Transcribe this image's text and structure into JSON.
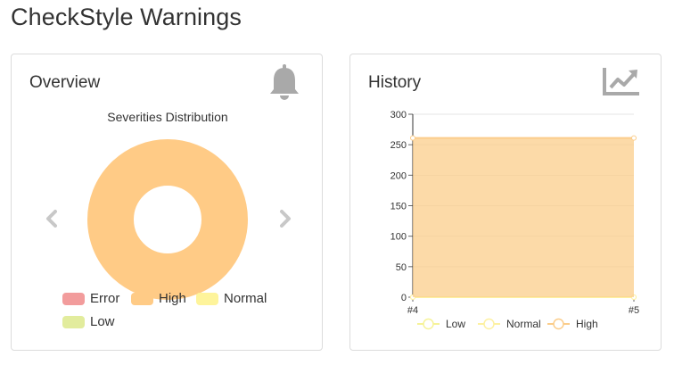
{
  "page": {
    "title": "CheckStyle Warnings"
  },
  "overview": {
    "title": "Overview",
    "icon": "bell-icon",
    "subtitle": "Severities Distribution",
    "prev_icon": "chevron-left-icon",
    "next_icon": "chevron-right-icon",
    "legend": [
      {
        "label": "Error",
        "color": "#f29c9c"
      },
      {
        "label": "High",
        "color": "#ffcb86"
      },
      {
        "label": "Normal",
        "color": "#fef49b"
      },
      {
        "label": "Low",
        "color": "#e2ec9d"
      }
    ]
  },
  "history": {
    "title": "History",
    "icon": "trend-chart-icon",
    "legend": [
      {
        "label": "Low",
        "color": "#f6f399"
      },
      {
        "label": "Normal",
        "color": "#fdf1a2"
      },
      {
        "label": "High",
        "color": "#fbcd8b"
      }
    ]
  },
  "chart_data": [
    {
      "type": "pie",
      "title": "Severities Distribution",
      "categories": [
        "Error",
        "High",
        "Normal",
        "Low"
      ],
      "values": [
        0,
        261,
        0,
        0
      ],
      "colors": [
        "#f29c9c",
        "#ffcb86",
        "#fef49b",
        "#e2ec9d"
      ],
      "legend_position": "bottom"
    },
    {
      "type": "area",
      "x": [
        "#4",
        "#5"
      ],
      "series": [
        {
          "name": "Low",
          "values": [
            0,
            0
          ],
          "color": "#f6f399"
        },
        {
          "name": "Normal",
          "values": [
            0,
            0
          ],
          "color": "#fdf1a2"
        },
        {
          "name": "High",
          "values": [
            261,
            261
          ],
          "color": "#fbcd8b"
        }
      ],
      "ylim": [
        0,
        300
      ],
      "yticks": [
        0,
        50,
        100,
        150,
        200,
        250,
        300
      ],
      "stacked": true,
      "grid": true,
      "legend_position": "bottom"
    }
  ]
}
